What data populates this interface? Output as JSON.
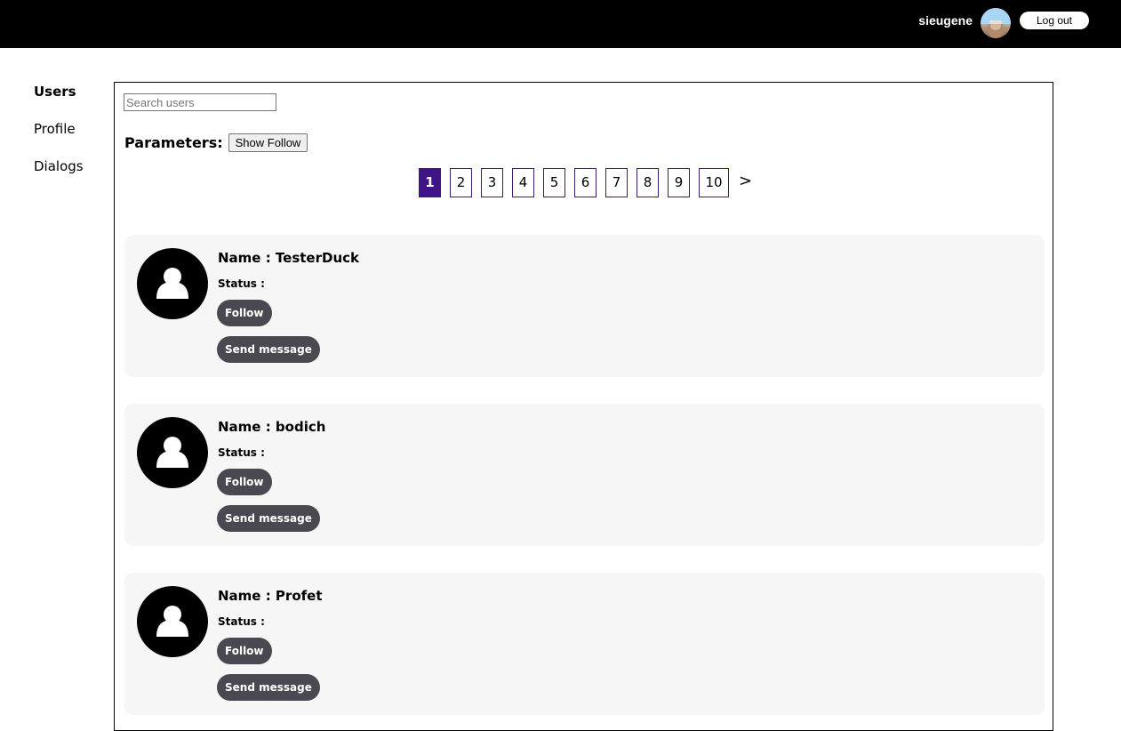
{
  "header": {
    "username": "sieugene",
    "avatar_icon": "user-photo-icon",
    "logout_label": "Log out",
    "background": "#000000"
  },
  "sidebar": {
    "items": [
      {
        "label": "Users",
        "active": true
      },
      {
        "label": "Profile",
        "active": false
      },
      {
        "label": "Dialogs",
        "active": false
      }
    ]
  },
  "search": {
    "placeholder": "Search users",
    "value": ""
  },
  "parameters": {
    "label": "Parameters:",
    "show_follow_label": "Show Follow"
  },
  "pagination": {
    "pages": [
      "1",
      "2",
      "3",
      "4",
      "5",
      "6",
      "7",
      "8",
      "9",
      "10"
    ],
    "current": "1",
    "next_label": ">",
    "accent_color": "#3f1585"
  },
  "users": [
    {
      "name": "Name : TesterDuck",
      "status": "Status :",
      "follow_label": "Follow",
      "message_label": "Send message",
      "avatar_icon": "default-user-icon"
    },
    {
      "name": "Name : bodich",
      "status": "Status :",
      "follow_label": "Follow",
      "message_label": "Send message",
      "avatar_icon": "default-user-icon"
    },
    {
      "name": "Name : Profet",
      "status": "Status :",
      "follow_label": "Follow",
      "message_label": "Send message",
      "avatar_icon": "default-user-icon"
    }
  ]
}
